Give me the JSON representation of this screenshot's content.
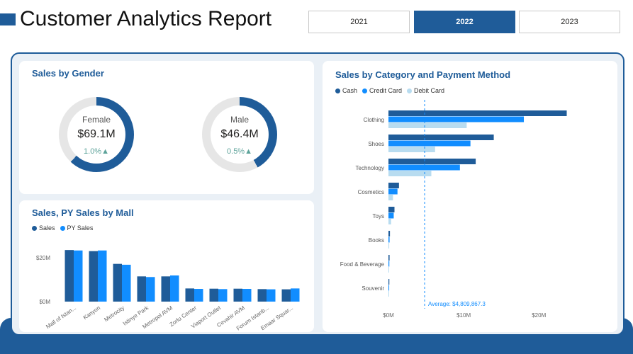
{
  "header": {
    "title": "Customer Analytics Report",
    "year_slicer": [
      {
        "label": "2021",
        "selected": false
      },
      {
        "label": "2022",
        "selected": true
      },
      {
        "label": "2023",
        "selected": false
      }
    ]
  },
  "colors": {
    "primary": "#1f5c99",
    "bright": "#118dff",
    "light": "#b8dcf0",
    "track": "#e6e6e6",
    "positive": "#5da39a"
  },
  "gender_card": {
    "title": "Sales by Gender",
    "female": {
      "label": "Female",
      "value": "$69.1M",
      "change": "1.0%▲",
      "share": 0.62
    },
    "male": {
      "label": "Male",
      "value": "$46.4M",
      "change": "0.5%▲",
      "share": 0.42
    }
  },
  "mall_card": {
    "title": "Sales, PY Sales by Mall",
    "legend": [
      "Sales",
      "PY Sales"
    ]
  },
  "category_card": {
    "title": "Sales by Category and Payment Method",
    "legend": [
      "Cash",
      "Credit Card",
      "Debit Card"
    ]
  },
  "chart_data": [
    {
      "type": "bar",
      "title": "Sales, PY Sales by Mall",
      "categories": [
        "Mall of Istan...",
        "Kanyon",
        "Metrocity",
        "Istinye Park",
        "Metropol AVM",
        "Zorlu Center",
        "Viaport Outlet",
        "Cevahir AVM",
        "Forum Istanb...",
        "Emaar Squar..."
      ],
      "series": [
        {
          "name": "Sales",
          "values": [
            23.5,
            23.0,
            17.2,
            11.5,
            11.5,
            6.0,
            5.9,
            5.9,
            5.7,
            5.6
          ]
        },
        {
          "name": "PY Sales",
          "values": [
            23.3,
            23.3,
            16.8,
            11.2,
            11.9,
            5.8,
            5.7,
            5.8,
            5.6,
            6.0
          ]
        }
      ],
      "ylim": [
        0,
        30
      ],
      "yticks": [
        "$0M",
        "$20M"
      ],
      "ytick_values": [
        0,
        20
      ],
      "legend": "top-left",
      "grid": false
    },
    {
      "type": "bar",
      "orientation": "horizontal",
      "title": "Sales by Category and Payment Method",
      "categories": [
        "Clothing",
        "Shoes",
        "Technology",
        "Cosmetics",
        "Toys",
        "Books",
        "Food & Beverage",
        "Souvenir"
      ],
      "series": [
        {
          "name": "Cash",
          "values": [
            23.7,
            14.0,
            11.6,
            1.4,
            0.8,
            0.2,
            0.15,
            0.12
          ]
        },
        {
          "name": "Credit Card",
          "values": [
            18.0,
            10.9,
            9.5,
            1.2,
            0.7,
            0.15,
            0.12,
            0.1
          ]
        },
        {
          "name": "Debit Card",
          "values": [
            10.4,
            6.2,
            5.7,
            0.6,
            0.35,
            0.1,
            0.08,
            0.07
          ]
        }
      ],
      "xlim": [
        0,
        24.5
      ],
      "xticks": [
        "$0M",
        "$10M",
        "$20M"
      ],
      "xtick_values": [
        0,
        10,
        20
      ],
      "average_line": {
        "value": 4.81,
        "label": "Average: $4,809,867.3"
      },
      "legend": "top-left",
      "grid": false
    }
  ]
}
